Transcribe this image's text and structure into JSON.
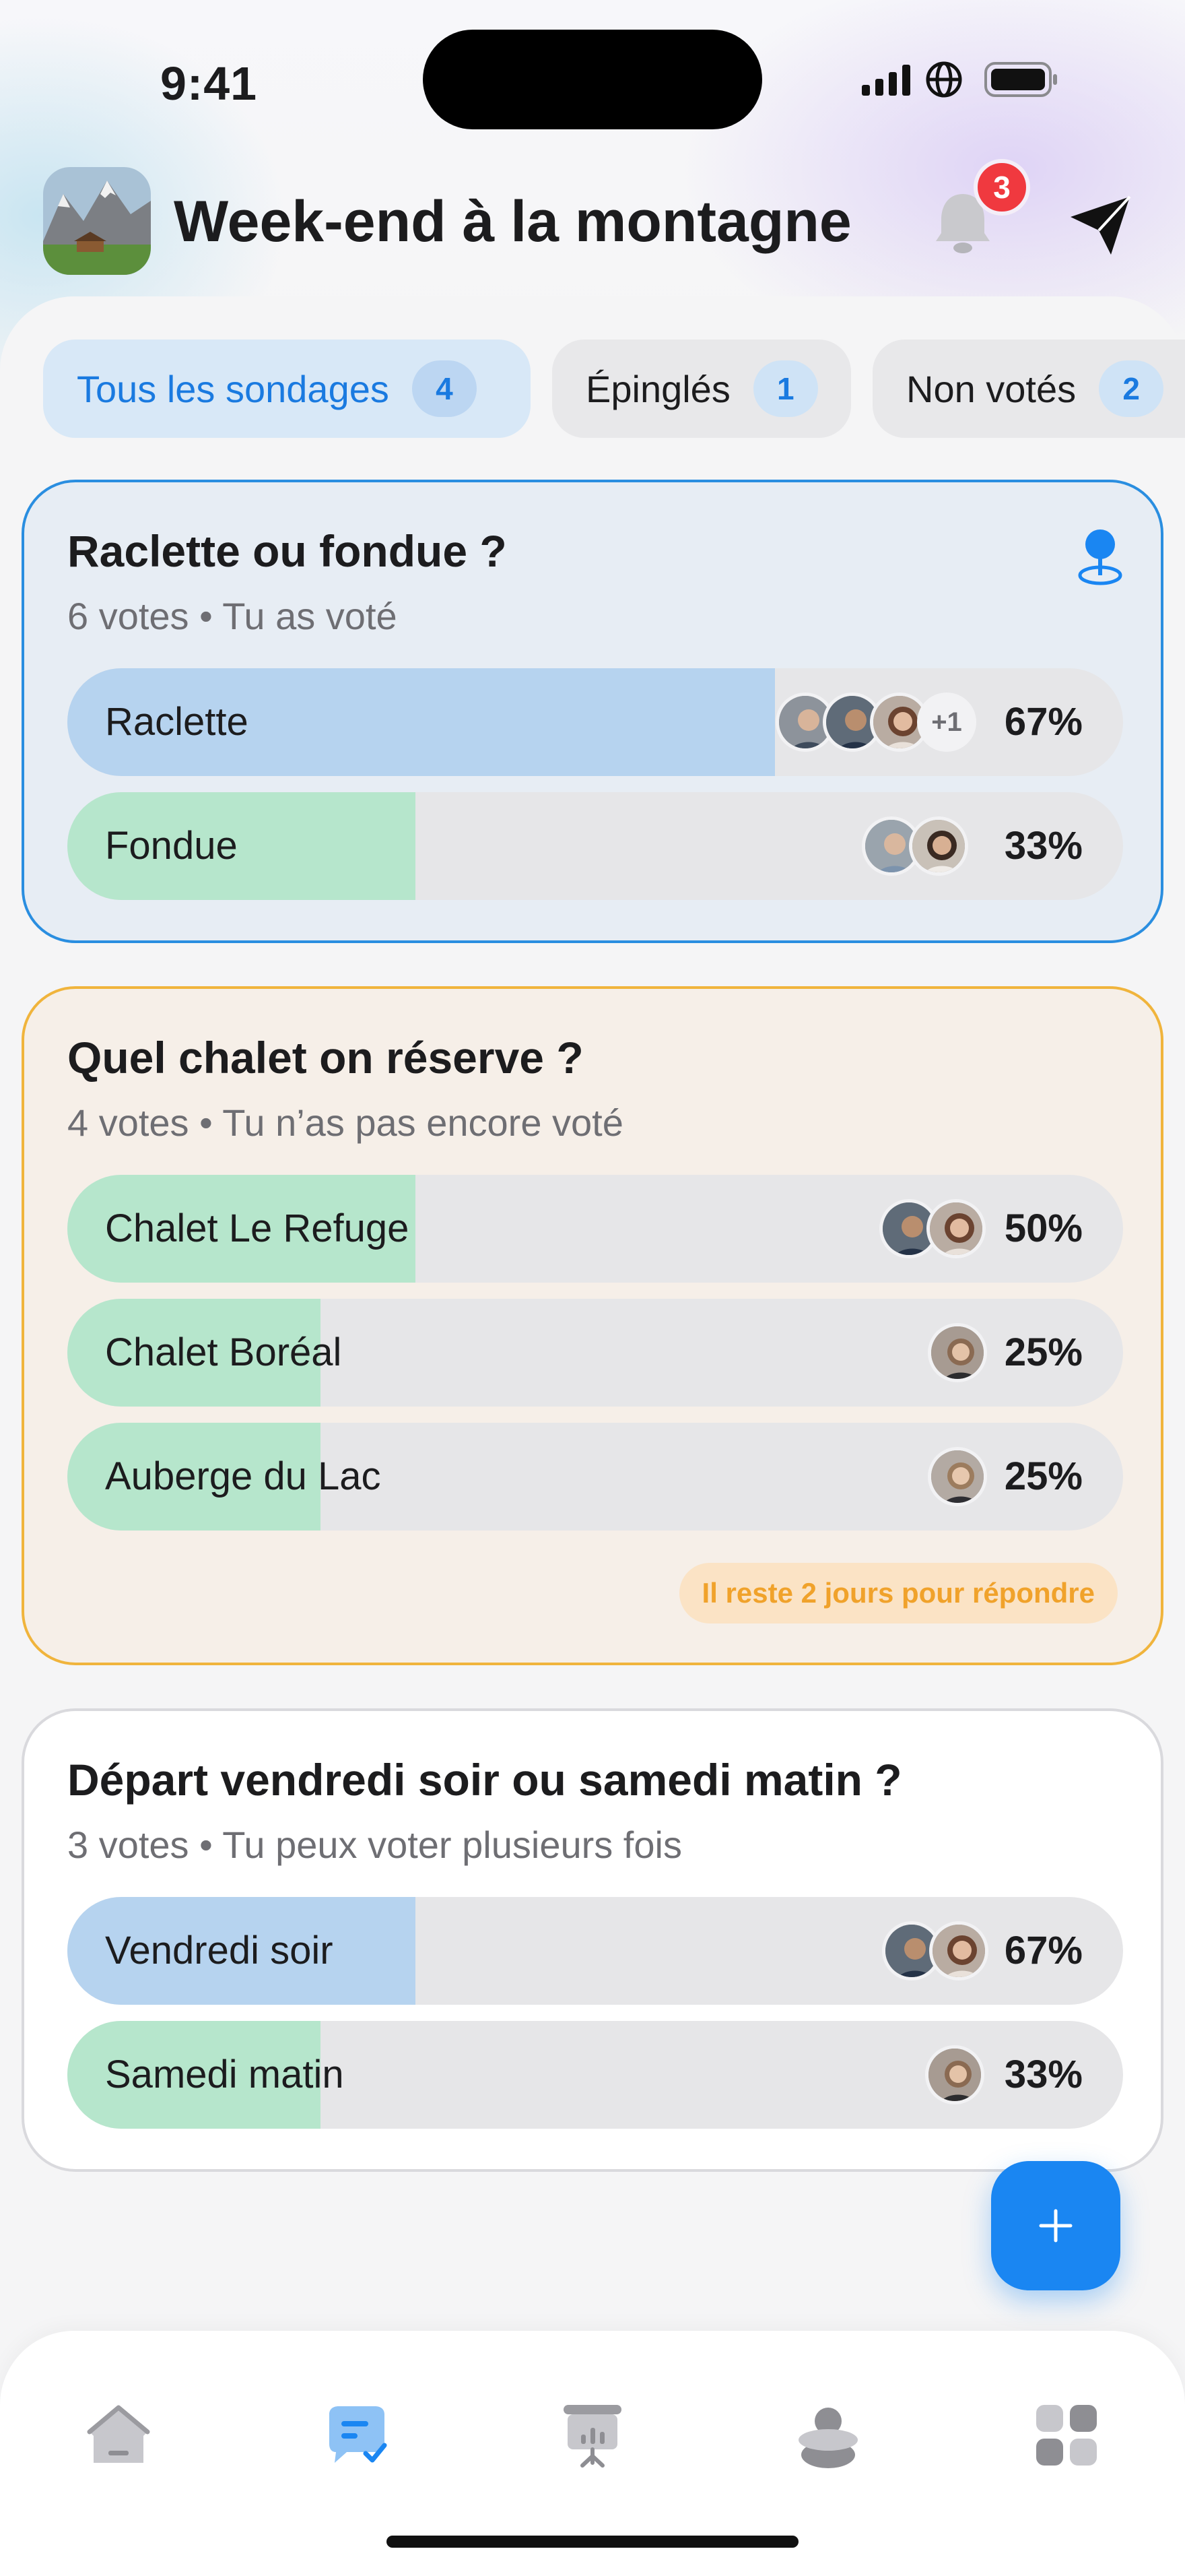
{
  "status_bar": {
    "time": "9:41"
  },
  "header": {
    "title": "Week-end à la montagne",
    "notification_count": "3"
  },
  "filters": [
    {
      "label": "Tous les sondages",
      "count": "4",
      "active": true
    },
    {
      "label": "Épinglés",
      "count": "1",
      "active": false
    },
    {
      "label": "Non votés",
      "count": "2",
      "active": false
    }
  ],
  "polls": [
    {
      "title": "Raclette ou fondue ?",
      "subtitle": "6 votes • Tu as voté",
      "pinned": true,
      "options": [
        {
          "label": "Raclette",
          "percent": "67%",
          "value": 0.67,
          "color": "#b6d3ef",
          "extra_voters": "+1"
        },
        {
          "label": "Fondue",
          "percent": "33%",
          "value": 0.33,
          "color": "#b6e6cc"
        }
      ]
    },
    {
      "title": "Quel chalet on réserve ?",
      "subtitle": "4 votes • Tu n’as pas encore voté",
      "deadline": "Il reste 2 jours pour répondre",
      "options": [
        {
          "label": "Chalet Le Refuge",
          "percent": "50%",
          "value": 0.33,
          "color": "#b6e6cc"
        },
        {
          "label": "Chalet Boréal",
          "percent": "25%",
          "value": 0.24,
          "color": "#b6e6cc"
        },
        {
          "label": "Auberge du Lac",
          "percent": "25%",
          "value": 0.24,
          "color": "#b6e6cc"
        }
      ]
    },
    {
      "title": "Départ vendredi soir ou samedi matin ?",
      "subtitle": "3 votes • Tu peux voter plusieurs fois",
      "options": [
        {
          "label": "Vendredi soir",
          "percent": "67%",
          "value": 0.33,
          "color": "#b6d3ef"
        },
        {
          "label": "Samedi matin",
          "percent": "33%",
          "value": 0.24,
          "color": "#b6e6cc"
        }
      ]
    }
  ],
  "tabbar": {
    "icons": [
      "home-icon",
      "polls-icon",
      "presentation-icon",
      "people-icon",
      "apps-icon"
    ],
    "active_index": 1,
    "accent": "#1a86f2"
  }
}
